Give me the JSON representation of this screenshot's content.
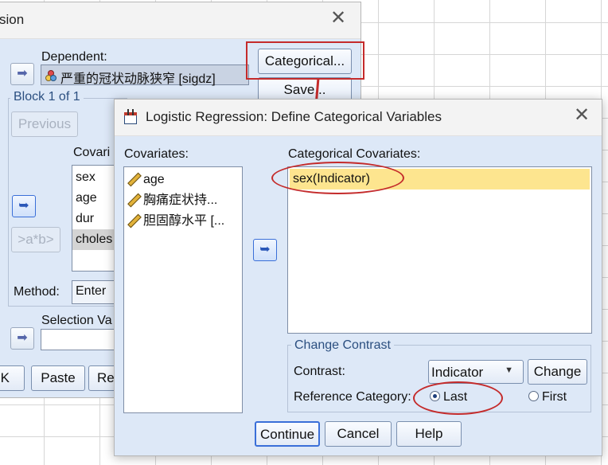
{
  "main_dialog": {
    "title": "sion",
    "dependent_label": "Dependent:",
    "dependent_value": "严重的冠状动脉狭窄 [sigdz]",
    "categorical_button": "Categorical...",
    "save_button": "Save...",
    "block_label": "Block 1 of 1",
    "previous_button": "Previous",
    "covariates_label": "Covari",
    "covariates": [
      "sex",
      "age",
      "dur",
      "choles"
    ],
    "interaction_button": ">a*b>",
    "method_label": "Method:",
    "method_value": "Enter",
    "selection_label": "Selection Va",
    "ok_button": "K",
    "paste_button": "Paste",
    "reset_button": "Re"
  },
  "define_dialog": {
    "title": "Logistic Regression: Define Categorical Variables",
    "covariates_label": "Covariates:",
    "covariates": [
      {
        "label": "age",
        "icon": "scale-ruler-icon"
      },
      {
        "label": "胸痛症状持...",
        "icon": "scale-ruler-icon"
      },
      {
        "label": "胆固醇水平 [...",
        "icon": "scale-ruler-icon"
      }
    ],
    "categorical_label": "Categorical Covariates:",
    "categorical_items": [
      "sex(Indicator)"
    ],
    "change_contrast_legend": "Change Contrast",
    "contrast_label": "Contrast:",
    "contrast_value": "Indicator",
    "change_button": "Change",
    "reference_label": "Reference Category:",
    "radio_last": "Last",
    "radio_first": "First",
    "reference_selected": "Last",
    "continue_button": "Continue",
    "cancel_button": "Cancel",
    "help_button": "Help"
  },
  "colors": {
    "dialog_bg": "#dde8f7",
    "selected_row": "#fde58f",
    "annotation_red": "#c42b2b",
    "legend_text": "#2b4f80"
  }
}
